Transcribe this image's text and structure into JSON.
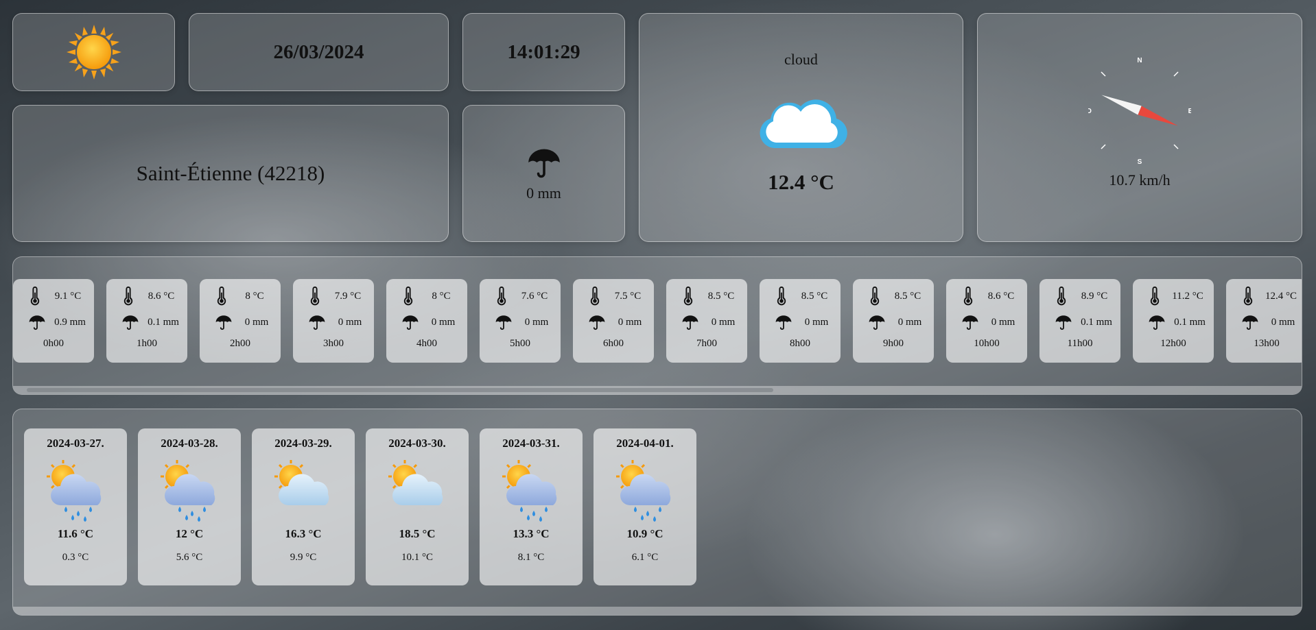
{
  "header": {
    "date": "26/03/2024",
    "time": "14:01:29",
    "city": "Saint-Étienne (42218)",
    "rain": "0 mm",
    "condition": "cloud",
    "temperature": "12.4 °C",
    "wind": {
      "speed": "10.7 km/h",
      "labels": {
        "n": "N",
        "e": "E",
        "s": "S",
        "w": "O"
      },
      "direction_deg": 112
    }
  },
  "colors": {
    "compass_red": "#e8483d",
    "compass_white": "#f4f4f4"
  },
  "hourly": [
    {
      "temp": "9.1 °C",
      "rain": "0.9 mm",
      "time": "0h00"
    },
    {
      "temp": "8.6 °C",
      "rain": "0.1 mm",
      "time": "1h00"
    },
    {
      "temp": "8 °C",
      "rain": "0 mm",
      "time": "2h00"
    },
    {
      "temp": "7.9 °C",
      "rain": "0 mm",
      "time": "3h00"
    },
    {
      "temp": "8 °C",
      "rain": "0 mm",
      "time": "4h00"
    },
    {
      "temp": "7.6 °C",
      "rain": "0 mm",
      "time": "5h00"
    },
    {
      "temp": "7.5 °C",
      "rain": "0 mm",
      "time": "6h00"
    },
    {
      "temp": "8.5 °C",
      "rain": "0 mm",
      "time": "7h00"
    },
    {
      "temp": "8.5 °C",
      "rain": "0 mm",
      "time": "8h00"
    },
    {
      "temp": "8.5 °C",
      "rain": "0 mm",
      "time": "9h00"
    },
    {
      "temp": "8.6 °C",
      "rain": "0 mm",
      "time": "10h00"
    },
    {
      "temp": "8.9 °C",
      "rain": "0.1 mm",
      "time": "11h00"
    },
    {
      "temp": "11.2 °C",
      "rain": "0.1 mm",
      "time": "12h00"
    },
    {
      "temp": "12.4 °C",
      "rain": "0 mm",
      "time": "13h00"
    }
  ],
  "daily": [
    {
      "date": "2024-03-27.",
      "icon": "sun-cloud-rain-icon",
      "max": "11.6 °C",
      "min": "0.3 °C"
    },
    {
      "date": "2024-03-28.",
      "icon": "sun-cloud-rain-icon",
      "max": "12 °C",
      "min": "5.6 °C"
    },
    {
      "date": "2024-03-29.",
      "icon": "sun-cloud-icon",
      "max": "16.3 °C",
      "min": "9.9 °C"
    },
    {
      "date": "2024-03-30.",
      "icon": "sun-cloud-icon",
      "max": "18.5 °C",
      "min": "10.1 °C"
    },
    {
      "date": "2024-03-31.",
      "icon": "sun-cloud-rain-icon",
      "max": "13.3 °C",
      "min": "8.1 °C"
    },
    {
      "date": "2024-04-01.",
      "icon": "sun-cloud-rain-icon",
      "max": "10.9 °C",
      "min": "6.1 °C"
    }
  ]
}
